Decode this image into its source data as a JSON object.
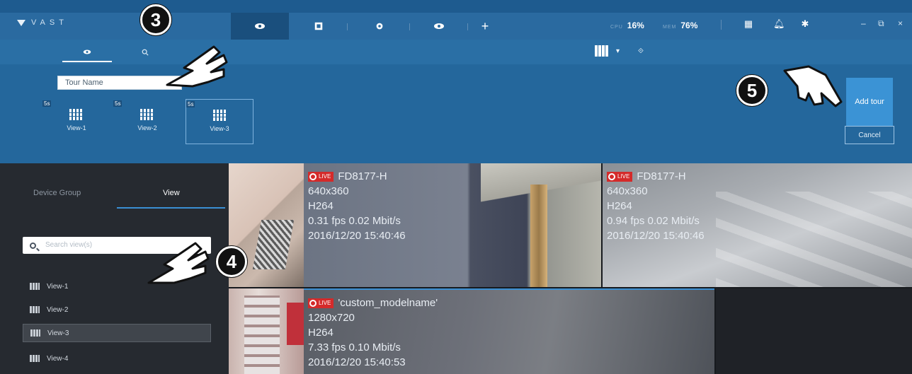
{
  "app": {
    "brand": "VAST"
  },
  "toolbar": {
    "cpu_label": "CPU",
    "cpu_value": "16%",
    "mem_label": "MEM",
    "mem_value": "76%"
  },
  "tour": {
    "name_value": "Tour Name",
    "views": [
      {
        "duration": "5s",
        "label": "View-1"
      },
      {
        "duration": "5s",
        "label": "View-2"
      },
      {
        "duration": "5s",
        "label": "View-3"
      }
    ],
    "add_label": "Add tour",
    "cancel_label": "Cancel"
  },
  "sidebar": {
    "tabs": [
      {
        "label": "Device Group"
      },
      {
        "label": "View"
      }
    ],
    "search_placeholder": "Search view(s)",
    "items": [
      {
        "label": "View-1"
      },
      {
        "label": "View-2"
      },
      {
        "label": "View-3"
      },
      {
        "label": "View-4"
      }
    ]
  },
  "streams": [
    {
      "live": "LIVE",
      "name": "FD8177-H",
      "resolution": "640x360",
      "codec": "H264",
      "rate": "0.31 fps  0.02 Mbit/s",
      "time": "2016/12/20 15:40:46"
    },
    {
      "live": "LIVE",
      "name": "FD8177-H",
      "resolution": "640x360",
      "codec": "H264",
      "rate": "0.94 fps  0.02 Mbit/s",
      "time": "2016/12/20 15:40:46"
    },
    {
      "live": "LIVE",
      "name": "'custom_modelname'",
      "resolution": "1280x720",
      "codec": "H264",
      "rate": "7.33 fps  0.10 Mbit/s",
      "time": "2016/12/20 15:40:53"
    }
  ],
  "markers": {
    "m3": "3",
    "m4": "4",
    "m5": "5"
  }
}
